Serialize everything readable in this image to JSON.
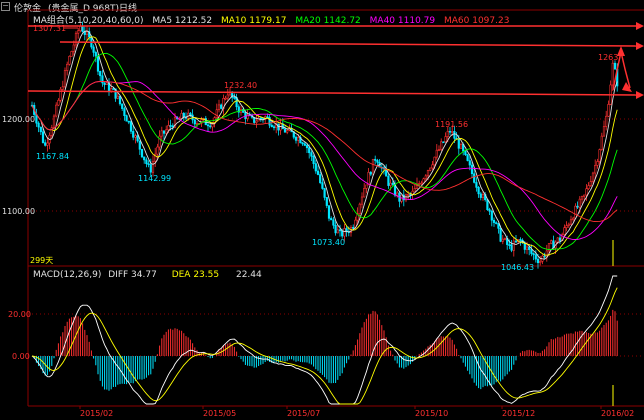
{
  "title_bar": {
    "symbol": "伦敦金",
    "subtitle": "(贵金属_D  968T)日线",
    "icon": "minimize-icon"
  },
  "ma_legend": [
    {
      "label": "MA组合(5,10,20,40,60,0)",
      "color": "#e0e0e0"
    },
    {
      "label": "MA5 1212.52",
      "color": "#e0e0e0"
    },
    {
      "label": "MA10 1179.17",
      "color": "#ffff00"
    },
    {
      "label": "MA20 1142.72",
      "color": "#00ff00"
    },
    {
      "label": "MA40 1110.79",
      "color": "#ff00ff"
    },
    {
      "label": "MA60 1097.23",
      "color": "#ff3030"
    }
  ],
  "price_axis": {
    "labels": [
      "1200.00",
      "1100.00"
    ]
  },
  "price_annotations": [
    {
      "text": "1307.31",
      "color": "#ff3030"
    },
    {
      "text": "1232.40",
      "color": "#ff3030"
    },
    {
      "text": "1191.56",
      "color": "#ff3030"
    },
    {
      "text": "1263",
      "color": "#ff3030"
    },
    {
      "text": "1167.84",
      "color": "#00e5ff"
    },
    {
      "text": "1142.99",
      "color": "#00e5ff"
    },
    {
      "text": "1073.40",
      "color": "#00e5ff"
    },
    {
      "text": "1046.43",
      "color": "#00e5ff"
    }
  ],
  "days_label": "299天",
  "macd_legend": {
    "name": "MACD(12,26,9)",
    "diff": "DIFF  34.77",
    "dea": "DEA  23.55",
    "macd": "22.44"
  },
  "macd_axis": {
    "labels": [
      "20.00",
      "0.00"
    ]
  },
  "date_axis": {
    "labels": [
      "2015/02",
      "2015/05",
      "2015/07",
      "2015/10",
      "2015/12",
      "2016/02"
    ]
  },
  "colors": {
    "background": "#000000",
    "up": "#ff3030",
    "down": "#00e5ff",
    "grid": "#8b0000",
    "ma5": "#e0e0e0",
    "ma10": "#ffff00",
    "ma20": "#00ff00",
    "ma40": "#ff00ff",
    "ma60": "#ff3030"
  }
}
